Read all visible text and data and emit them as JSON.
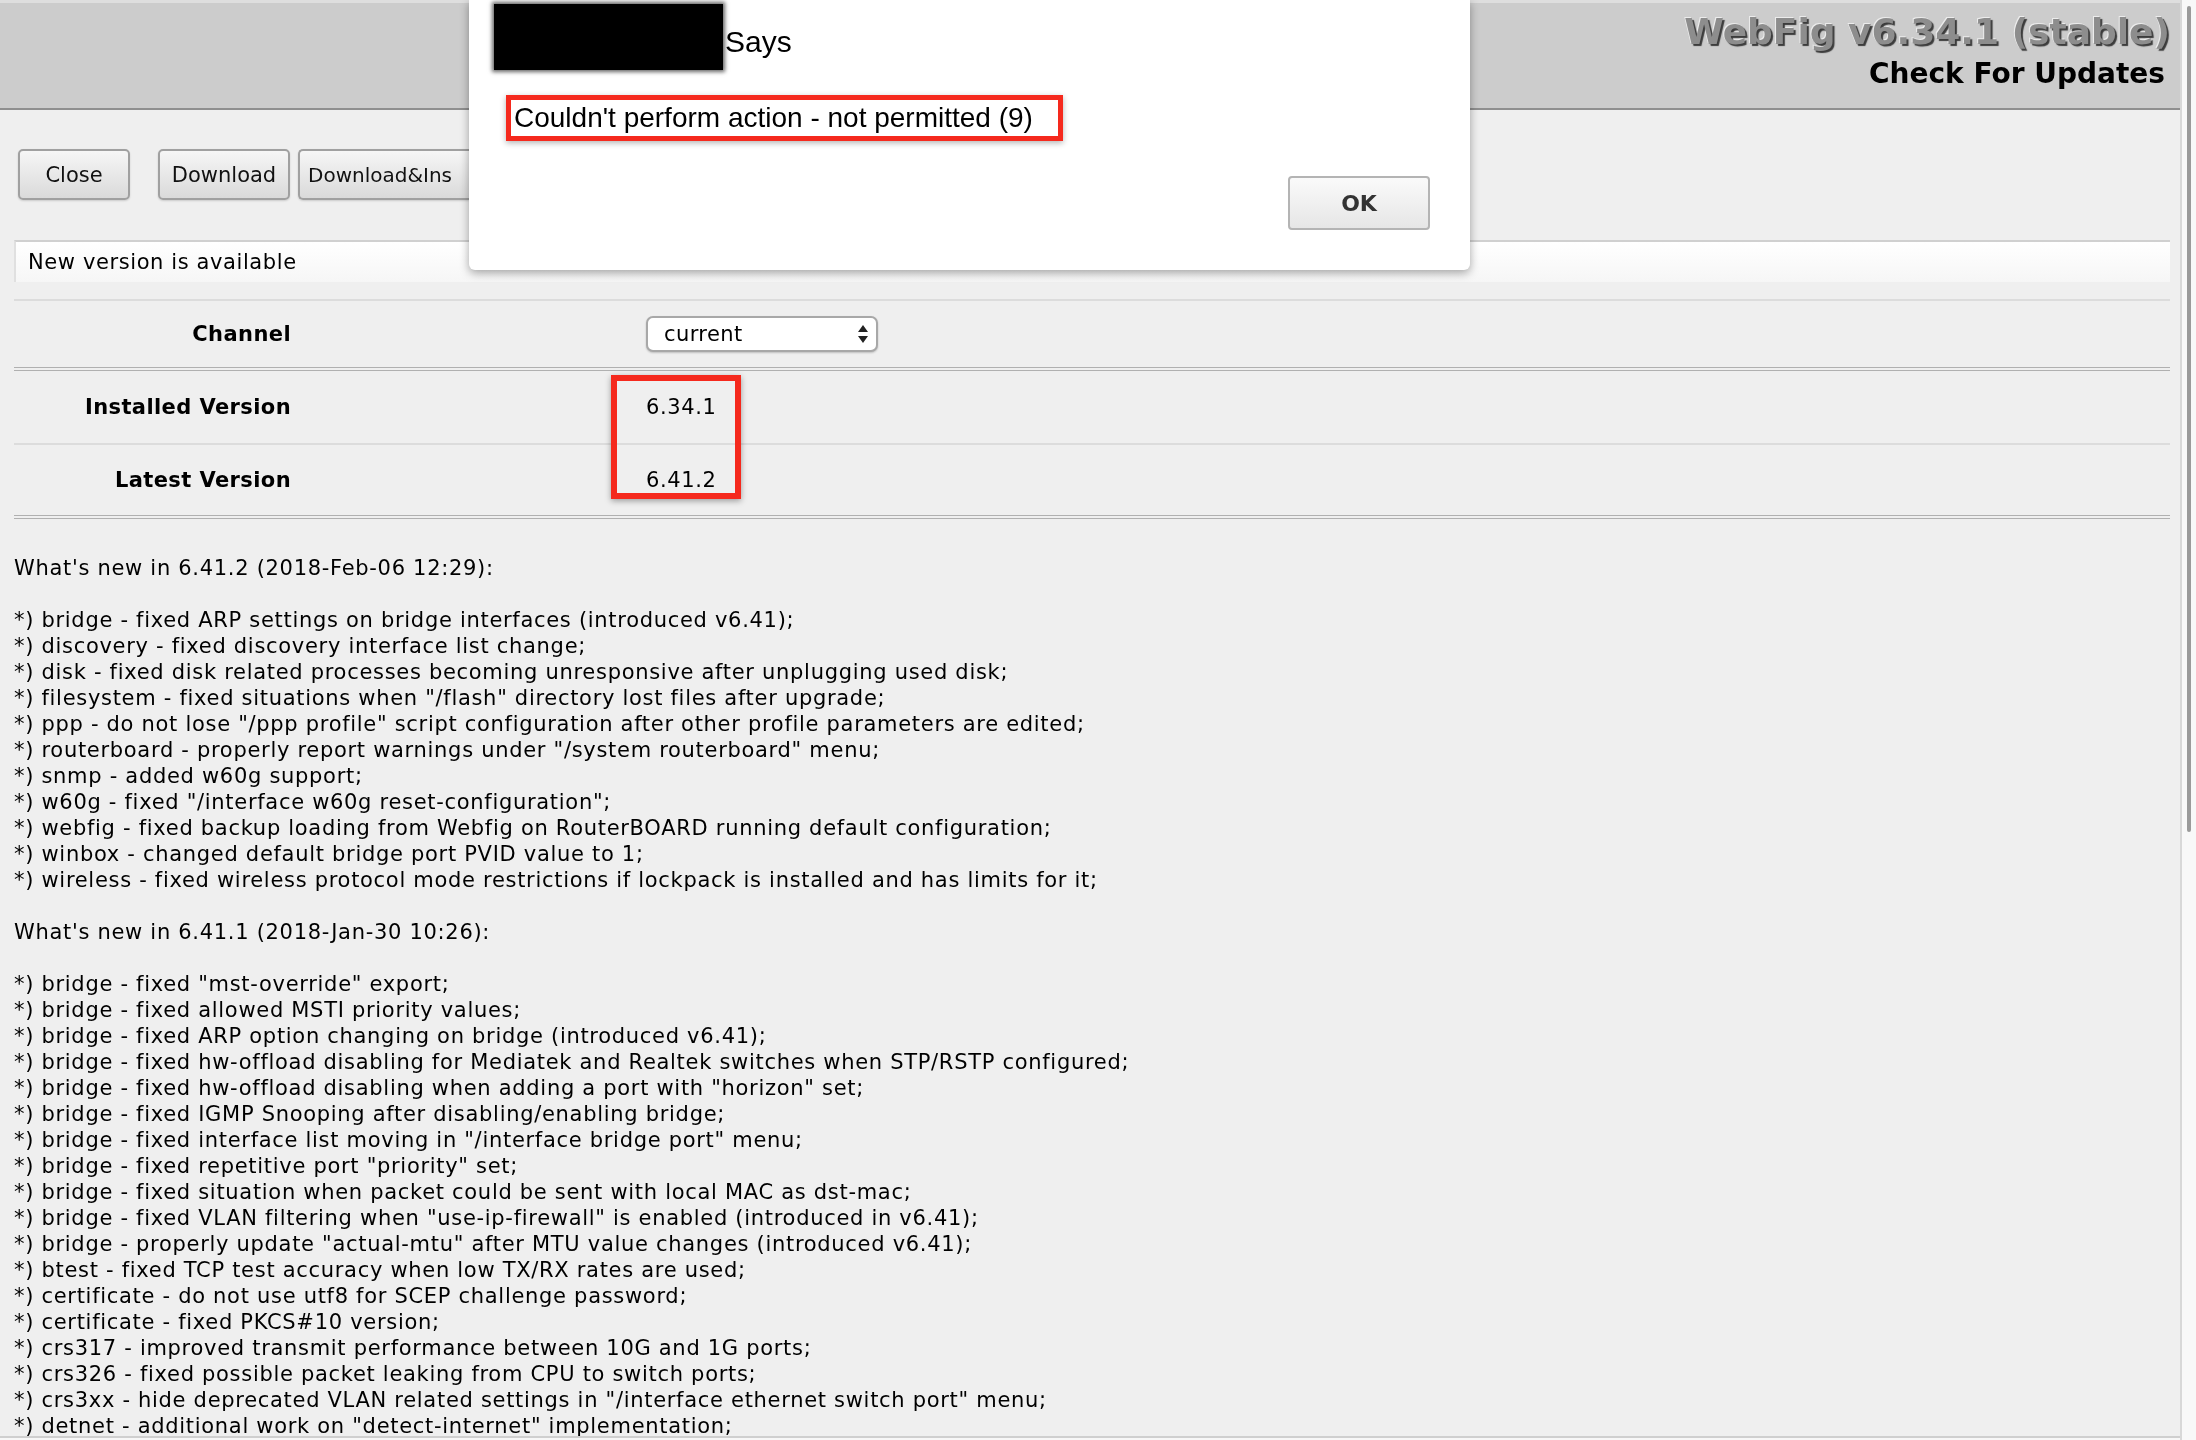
{
  "header": {
    "title": "WebFig v6.34.1 (stable)",
    "subtitle": "Check For Updates"
  },
  "toolbar": {
    "buttons": [
      {
        "label": "Close"
      },
      {
        "label": "Download"
      },
      {
        "label": "Download&Ins"
      }
    ]
  },
  "status_bar": {
    "text": "New version is available"
  },
  "form": {
    "channel": {
      "label": "Channel",
      "value": "current"
    },
    "versions": {
      "highlighted": true,
      "rows": [
        {
          "label": "Installed Version",
          "value": "6.34.1"
        },
        {
          "label": "Latest Version",
          "value": "6.41.2"
        }
      ]
    }
  },
  "changelog": [
    {
      "heading": "What's new in 6.41.2 (2018-Feb-06 12:29):",
      "items": [
        "*) bridge - fixed ARP settings on bridge interfaces (introduced v6.41);",
        "*) discovery - fixed discovery interface list change;",
        "*) disk - fixed disk related processes becoming unresponsive after unplugging used disk;",
        "*) filesystem - fixed situations when \"/flash\" directory lost files after upgrade;",
        "*) ppp - do not lose \"/ppp profile\" script configuration after other profile parameters are edited;",
        "*) routerboard - properly report warnings under \"/system routerboard\" menu;",
        "*) snmp - added w60g support;",
        "*) w60g - fixed \"/interface w60g reset-configuration\";",
        "*) webfig - fixed backup loading from Webfig on RouterBOARD running default configuration;",
        "*) winbox - changed default bridge port PVID value to 1;",
        "*) wireless - fixed wireless protocol mode restrictions if lockpack is installed and has limits for it;"
      ]
    },
    {
      "heading": "What's new in 6.41.1 (2018-Jan-30 10:26):",
      "items": [
        "*) bridge - fixed \"mst-override\" export;",
        "*) bridge - fixed allowed MSTI priority values;",
        "*) bridge - fixed ARP option changing on bridge (introduced v6.41);",
        "*) bridge - fixed hw-offload disabling for Mediatek and Realtek switches when STP/RSTP configured;",
        "*) bridge - fixed hw-offload disabling when adding a port with \"horizon\" set;",
        "*) bridge - fixed IGMP Snooping after disabling/enabling bridge;",
        "*) bridge - fixed interface list moving in \"/interface bridge port\" menu;",
        "*) bridge - fixed repetitive port \"priority\" set;",
        "*) bridge - fixed situation when packet could be sent with local MAC as dst-mac;",
        "*) bridge - fixed VLAN filtering when \"use-ip-firewall\" is enabled (introduced in v6.41);",
        "*) bridge - properly update \"actual-mtu\" after MTU value changes (introduced v6.41);",
        "*) btest - fixed TCP test accuracy when low TX/RX rates are used;",
        "*) certificate - do not use utf8 for SCEP challenge password;",
        "*) certificate - fixed PKCS#10 version;",
        "*) crs317 - improved transmit performance between 10G and 1G ports;",
        "*) crs326 - fixed possible packet leaking from CPU to switch ports;",
        "*) crs3xx - hide deprecated VLAN related settings in \"/interface ethernet switch port\" menu;",
        "*) detnet - additional work on \"detect-internet\" implementation;"
      ]
    }
  ],
  "dialog": {
    "title_redacted": true,
    "title": "Says",
    "message": "Couldn't perform action - not permitted (9)",
    "message_highlighted": true,
    "button": "OK"
  }
}
